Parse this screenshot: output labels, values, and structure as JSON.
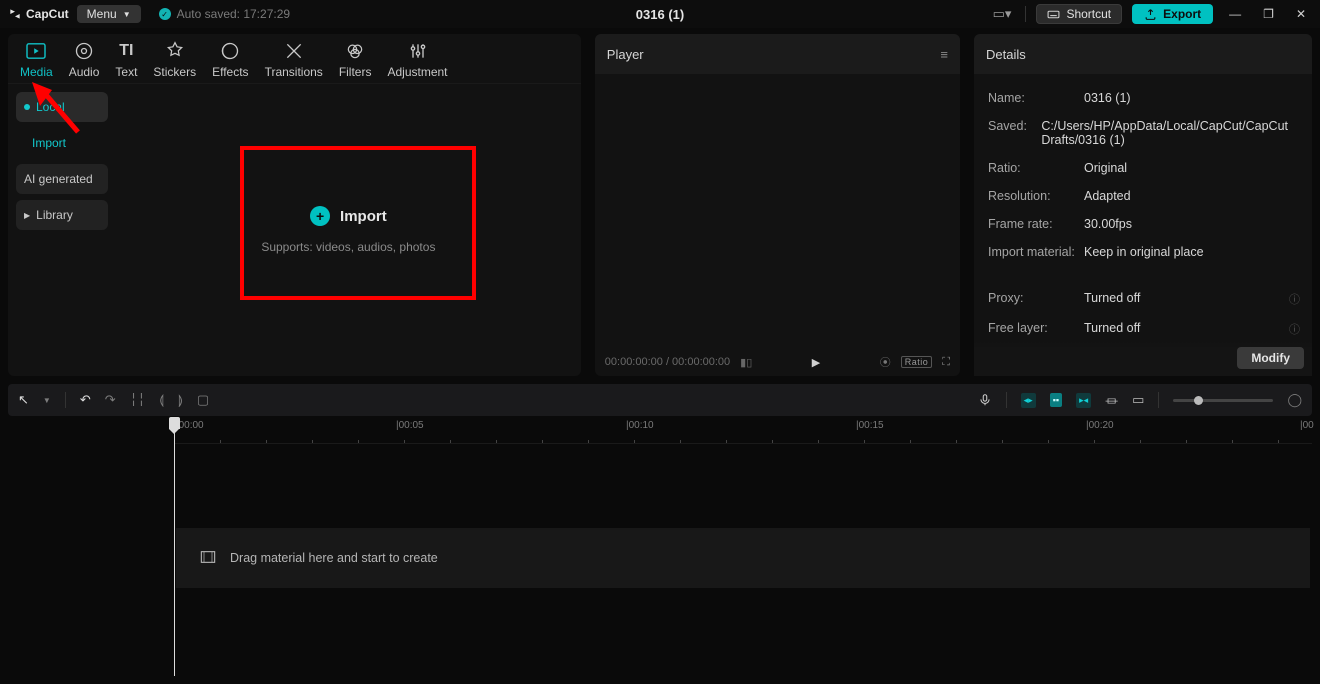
{
  "app": {
    "name": "CapCut",
    "menu": "Menu",
    "autosave": "Auto saved: 17:27:29",
    "project": "0316 (1)",
    "shortcut": "Shortcut",
    "export": "Export"
  },
  "cats": {
    "media": "Media",
    "audio": "Audio",
    "text": "Text",
    "stickers": "Stickers",
    "effects": "Effects",
    "transitions": "Transitions",
    "filters": "Filters",
    "adjustment": "Adjustment"
  },
  "side": {
    "local": "Local",
    "import": "Import",
    "ai": "AI generated",
    "library": "Library"
  },
  "import": {
    "label": "Import",
    "sub": "Supports: videos, audios, photos"
  },
  "player": {
    "title": "Player",
    "time": "00:00:00:00 / 00:00:00:00",
    "ratio": "Ratio"
  },
  "details": {
    "title": "Details",
    "rows": {
      "name_k": "Name:",
      "name_v": "0316 (1)",
      "saved_k": "Saved:",
      "saved_v": "C:/Users/HP/AppData/Local/CapCut/CapCut Drafts/0316 (1)",
      "ratio_k": "Ratio:",
      "ratio_v": "Original",
      "res_k": "Resolution:",
      "res_v": "Adapted",
      "fps_k": "Frame rate:",
      "fps_v": "30.00fps",
      "mat_k": "Import material:",
      "mat_v": "Keep in original place",
      "proxy_k": "Proxy:",
      "proxy_v": "Turned off",
      "free_k": "Free layer:",
      "free_v": "Turned off"
    },
    "modify": "Modify"
  },
  "timeline": {
    "ticks": [
      "|00:00",
      "|00:05",
      "|00:10",
      "|00:15",
      "|00:20",
      "|00"
    ],
    "drop": "Drag material here and start to create"
  }
}
